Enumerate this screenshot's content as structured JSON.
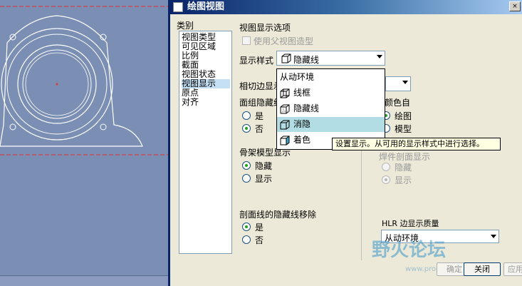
{
  "dialog": {
    "title": "绘图视图",
    "close": "×"
  },
  "category": {
    "label": "类别",
    "items": [
      "视图类型",
      "可见区域",
      "比例",
      "截面",
      "视图状态",
      "视图显示",
      "原点",
      "对齐"
    ]
  },
  "display_options": {
    "section_title": "视图显示选项",
    "use_parent_label": "使用父视图造型",
    "style_label": "显示样式",
    "style_value": "隐藏线",
    "tangent_label": "相切边显示",
    "tangent_hidden_label": "面组隐藏线",
    "yes": "是",
    "no": "否",
    "color_label": "颜色自",
    "color_drawing": "绘图",
    "color_model": "模型",
    "skeleton_label": "骨架模型显示",
    "hide": "隐藏",
    "show": "显示",
    "weld_label": "焊件剖面显示",
    "weld_hide": "隐藏",
    "weld_show": "显示",
    "section_hidden_label": "剖面线的隐藏线移除",
    "hlr_label": "HLR 边显示质量",
    "hlr_value": "从动环境"
  },
  "dropdown": {
    "items": [
      {
        "label": "从动环境",
        "icon": ""
      },
      {
        "label": "线框",
        "icon": "wireframe-icon"
      },
      {
        "label": "隐藏线",
        "icon": "hidden-line-icon"
      },
      {
        "label": "消隐",
        "icon": "no-hidden-icon"
      },
      {
        "label": "着色",
        "icon": "shaded-icon"
      }
    ]
  },
  "tooltip": "设置显示。从可用的显示样式中进行选择。",
  "buttons": {
    "ok": "确定",
    "close": "关闭",
    "apply": "应用"
  },
  "watermark": {
    "text": "野火论坛",
    "url": "www.proewildfire.cn"
  },
  "colors": {
    "title_bar": "#0a246a",
    "dialog_bg": "#ece9d8",
    "selection": "#b3dde4"
  }
}
